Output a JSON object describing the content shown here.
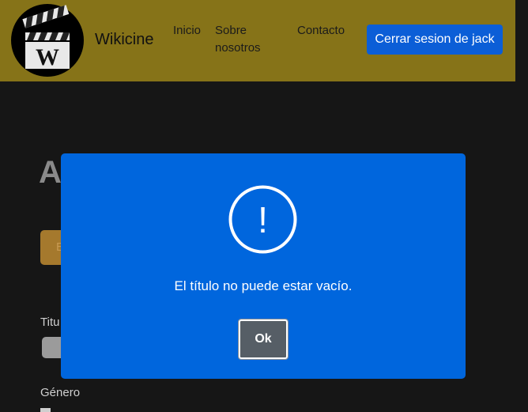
{
  "navbar": {
    "brand": "Wikicine",
    "links": [
      "Inicio",
      "Sobre nosotros",
      "Contacto"
    ],
    "logout_label": "Cerrar sesion de jack",
    "logo_letter": "W"
  },
  "page": {
    "heading": "A",
    "action_label": "E",
    "fields": [
      "Titu",
      "Género"
    ]
  },
  "modal": {
    "icon_glyph": "!",
    "message": "El título no puede estar vacío.",
    "ok_label": "Ok"
  },
  "colors": {
    "navbar_bg": "#867318",
    "modal_bg": "#0066dd",
    "logout_btn": "#0b5ed7",
    "ok_btn": "#565e66",
    "page_bg": "#161616"
  }
}
